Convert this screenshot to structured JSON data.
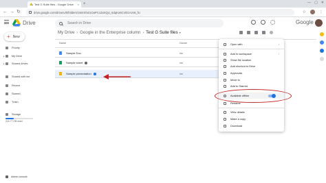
{
  "browser": {
    "tab_title": "Test G Suite files - Google Drive",
    "tab_close": "×",
    "new_tab": "+",
    "window_controls": [
      "—",
      "▢",
      "✕"
    ],
    "url": "drive.google.com/drive/u/0/folders/1W4Xfx01OaPCcZaXQU_6dqKo6CViEzAzv8_fU",
    "back": "←",
    "forward": "→",
    "reload": "↻"
  },
  "drive": {
    "app_name": "Drive",
    "search_placeholder": "Search in Drive",
    "google_wordmark": "Google",
    "new_label": "New",
    "new_plus": "+"
  },
  "sidebar": {
    "items": [
      {
        "label": "Priority",
        "icon": "priority-icon",
        "caret": ""
      },
      {
        "label": "My Drive",
        "icon": "my-drive-icon",
        "caret": "▸"
      },
      {
        "label": "Shared drives",
        "icon": "shared-drives-icon",
        "caret": "▸"
      },
      {
        "label": "Shared with me",
        "icon": "shared-with-me-icon",
        "caret": ""
      },
      {
        "label": "Recent",
        "icon": "recent-icon",
        "caret": ""
      },
      {
        "label": "Starred",
        "icon": "starred-icon",
        "caret": ""
      },
      {
        "label": "Trash",
        "icon": "trash-icon",
        "caret": ""
      },
      {
        "label": "Storage",
        "icon": "storage-icon",
        "caret": ""
      }
    ],
    "storage_text": "216.77 GB used",
    "storage_fraction": 0.3,
    "admin_console": "Admin console"
  },
  "breadcrumb": {
    "items": [
      "My Drive",
      "Google in the Enterprise column",
      "Test G Suite files"
    ],
    "separator": "›",
    "dropdown": "▾"
  },
  "file_list": {
    "columns": {
      "name": "Name",
      "owner": "Owner"
    },
    "rows": [
      {
        "name": "Sample Doc",
        "owner": "me",
        "type": "doc",
        "badge": false
      },
      {
        "name": "Sample sheet",
        "owner": "me",
        "type": "sheet",
        "badge": true
      },
      {
        "name": "Sample presentation",
        "owner": "me",
        "type": "slide",
        "badge": true
      }
    ]
  },
  "context_menu": {
    "items": [
      {
        "label": "Open with",
        "icon": "open-with-icon",
        "chevron": "›"
      },
      {
        "label": "Add to workspace",
        "icon": "add-workspace-icon",
        "chevron": "›"
      },
      {
        "label": "Show file location",
        "icon": "folder-icon",
        "chevron": ""
      },
      {
        "label": "Add shortcut to Drive",
        "icon": "shortcut-icon",
        "chevron": ""
      },
      {
        "label": "Approvals",
        "icon": "approvals-icon",
        "chevron": ""
      },
      {
        "label": "Move to",
        "icon": "move-icon",
        "chevron": ""
      },
      {
        "label": "Add to Starred",
        "icon": "star-icon",
        "chevron": ""
      },
      {
        "label": "Available offline",
        "icon": "offline-icon",
        "chevron": ""
      },
      {
        "label": "Rename",
        "icon": "rename-icon",
        "chevron": ""
      },
      {
        "label": "View details",
        "icon": "details-icon",
        "chevron": ""
      },
      {
        "label": "Make a copy",
        "icon": "copy-icon",
        "chevron": ""
      },
      {
        "label": "Download",
        "icon": "download-icon",
        "chevron": ""
      }
    ],
    "offline_toggle_on": true
  },
  "colors": {
    "annotation_red": "#c5221f",
    "selection_blue": "#e8f0fe",
    "accent_blue": "#1a73e8"
  }
}
